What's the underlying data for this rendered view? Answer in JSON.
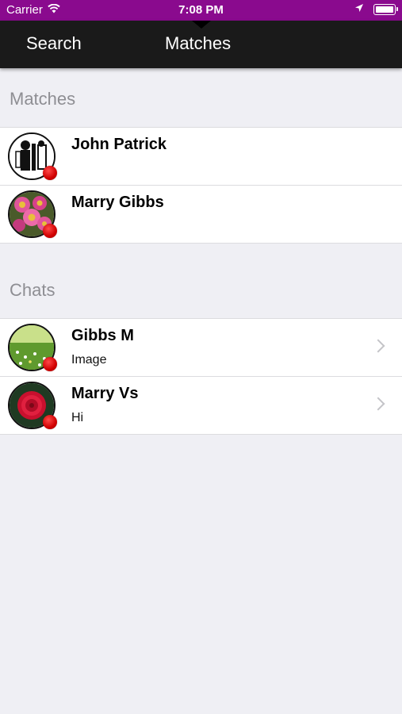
{
  "status_bar": {
    "carrier": "Carrier",
    "time": "7:08 PM",
    "wifi_icon": "wifi-icon",
    "location_icon": "location-arrow-icon",
    "battery_icon": "battery-icon"
  },
  "nav": {
    "tabs": [
      {
        "label": "Search"
      },
      {
        "label": "Matches"
      }
    ],
    "active_tab": "Matches"
  },
  "sections": {
    "matches": {
      "title": "Matches",
      "items": [
        {
          "name": "John Patrick",
          "avatar": "people-drawing-avatar",
          "status_color": "#e00000"
        },
        {
          "name": "Marry Gibbs",
          "avatar": "pink-flowers-avatar",
          "status_color": "#e00000"
        }
      ]
    },
    "chats": {
      "title": "Chats",
      "items": [
        {
          "name": "Gibbs M",
          "last_message": "Image",
          "avatar": "meadow-avatar",
          "status_color": "#e00000"
        },
        {
          "name": "Marry Vs",
          "last_message": "Hi",
          "avatar": "red-dahlia-avatar",
          "status_color": "#e00000"
        }
      ]
    }
  },
  "colors": {
    "status_bar": "#8a0a8e",
    "nav_bar": "#1a1a1a",
    "background": "#efeff4",
    "section_header_text": "#8e8e93"
  }
}
